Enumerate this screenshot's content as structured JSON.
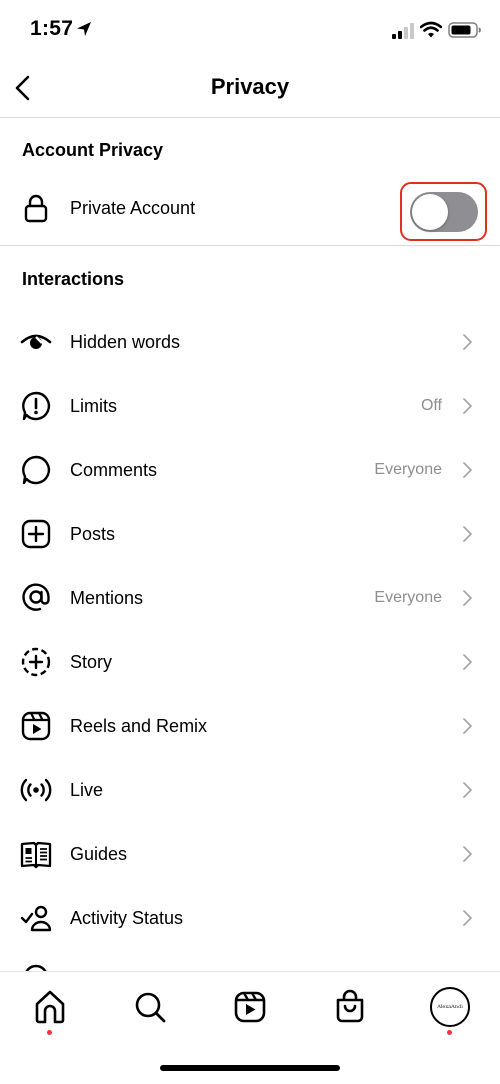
{
  "status_bar": {
    "time": "1:57"
  },
  "header": {
    "title": "Privacy"
  },
  "account_privacy": {
    "section_title": "Account Privacy",
    "private_account": {
      "label": "Private Account",
      "enabled": false
    }
  },
  "interactions": {
    "section_title": "Interactions",
    "items": [
      {
        "label": "Hidden words",
        "value": "",
        "icon": "hidden-words-icon"
      },
      {
        "label": "Limits",
        "value": "Off",
        "icon": "limits-icon"
      },
      {
        "label": "Comments",
        "value": "Everyone",
        "icon": "comment-icon"
      },
      {
        "label": "Posts",
        "value": "",
        "icon": "posts-icon"
      },
      {
        "label": "Mentions",
        "value": "Everyone",
        "icon": "at-icon"
      },
      {
        "label": "Story",
        "value": "",
        "icon": "story-icon"
      },
      {
        "label": "Reels and Remix",
        "value": "",
        "icon": "reels-icon"
      },
      {
        "label": "Live",
        "value": "",
        "icon": "live-icon"
      },
      {
        "label": "Guides",
        "value": "",
        "icon": "guides-icon"
      },
      {
        "label": "Activity Status",
        "value": "",
        "icon": "activity-status-icon"
      }
    ]
  },
  "tab_bar": {
    "tabs": [
      "home-icon",
      "search-icon",
      "reels-icon",
      "shop-icon",
      "profile-avatar"
    ],
    "avatar_text": "AlexaAndi"
  },
  "colors": {
    "toggle_off": "#8e8e93",
    "highlight": "#e0301e",
    "notification_dot": "#ff3040",
    "secondary_text": "#8e8e8e"
  }
}
